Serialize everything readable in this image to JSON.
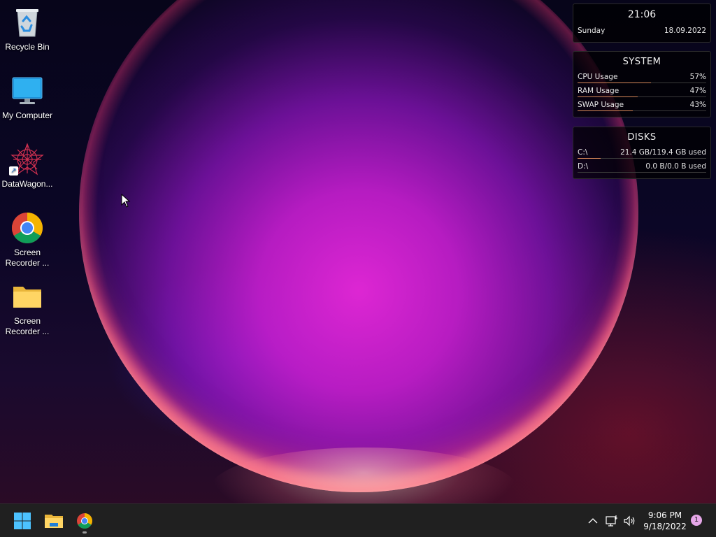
{
  "desktop": {
    "icons": [
      {
        "label": "Recycle Bin",
        "icon": "recycle-bin-icon"
      },
      {
        "label": "My Computer",
        "icon": "monitor-icon"
      },
      {
        "label": "DataWagon...",
        "icon": "datawagon-icon",
        "shortcut": true
      },
      {
        "label": "Screen\nRecorder ...",
        "line1": "Screen",
        "line2": "Recorder ...",
        "icon": "chrome-icon"
      },
      {
        "label": "Screen\nRecorder ...",
        "line1": "Screen",
        "line2": "Recorder ...",
        "icon": "folder-icon"
      }
    ]
  },
  "widgets": {
    "clock": {
      "time": "21:06",
      "day": "Sunday",
      "date": "18.09.2022"
    },
    "system": {
      "title": "SYSTEM",
      "rows": [
        {
          "label": "CPU Usage",
          "value": "57%",
          "fraction": 0.57
        },
        {
          "label": "RAM Usage",
          "value": "47%",
          "fraction": 0.47
        },
        {
          "label": "SWAP Usage",
          "value": "43%",
          "fraction": 0.43
        }
      ]
    },
    "disks": {
      "title": "DISKS",
      "rows": [
        {
          "label": "C:\\",
          "value": "21.4 GB/119.4 GB used",
          "fraction": 0.179
        },
        {
          "label": "D:\\",
          "value": "0.0 B/0.0 B used",
          "fraction": 0.0
        }
      ]
    }
  },
  "taskbar": {
    "pinned": [
      {
        "name": "start-button",
        "icon": "windows-logo-icon"
      },
      {
        "name": "file-explorer-button",
        "icon": "folder-icon"
      },
      {
        "name": "chrome-button",
        "icon": "chrome-icon",
        "running": true
      }
    ],
    "tray": {
      "time": "9:06 PM",
      "date": "9/18/2022",
      "notifications": "1"
    }
  },
  "colors": {
    "accent_bar": "#d98a5a",
    "taskbar_bg": "#202020",
    "badge": "#e6a7e8"
  }
}
